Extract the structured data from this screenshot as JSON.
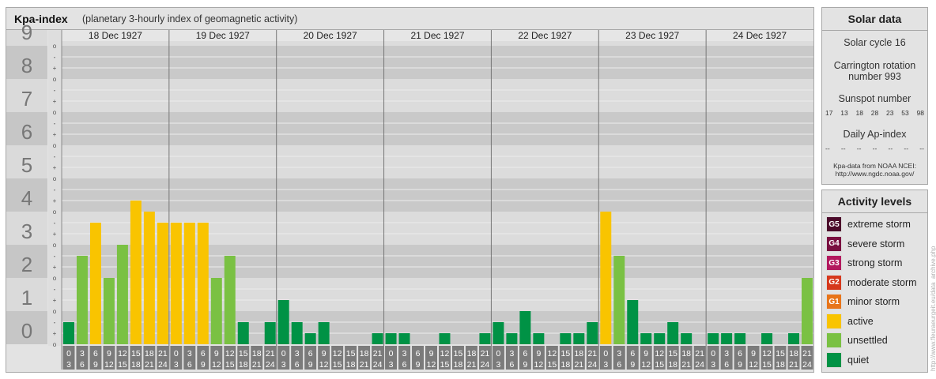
{
  "header": {
    "title": "Kpa-index",
    "subtitle": "(planetary 3-hourly index of geomagnetic activity)"
  },
  "chart_data": {
    "type": "bar",
    "y_axis_labels": [
      "0",
      "1",
      "2",
      "3",
      "4",
      "5",
      "6",
      "7",
      "8",
      "9"
    ],
    "minor_ticks": [
      "o",
      "+",
      "-"
    ],
    "ylim": [
      0,
      9
    ],
    "days": [
      "18 Dec 1927",
      "19 Dec 1927",
      "20 Dec 1927",
      "21 Dec 1927",
      "22 Dec 1927",
      "23 Dec 1927",
      "24 Dec 1927"
    ],
    "interval_starts": [
      "0",
      "3",
      "6",
      "9",
      "12",
      "15",
      "18",
      "21"
    ],
    "interval_ends": [
      "3",
      "6",
      "9",
      "12",
      "15",
      "18",
      "21",
      "24"
    ],
    "values": [
      [
        0.667,
        2.667,
        3.667,
        2.0,
        3.0,
        4.333,
        4.0,
        3.667
      ],
      [
        3.667,
        3.667,
        3.667,
        2.0,
        2.667,
        0.667,
        0.0,
        0.667
      ],
      [
        1.333,
        0.667,
        0.333,
        0.667,
        0.0,
        0.0,
        0.0,
        0.333
      ],
      [
        0.333,
        0.333,
        0.0,
        0.0,
        0.333,
        0.0,
        0.0,
        0.333
      ],
      [
        0.667,
        0.333,
        1.0,
        0.333,
        0.0,
        0.333,
        0.333,
        0.667
      ],
      [
        4.0,
        2.667,
        1.333,
        0.333,
        0.333,
        0.667,
        0.333,
        0.0
      ],
      [
        0.333,
        0.333,
        0.333,
        0.0,
        0.333,
        0.0,
        0.333,
        2.0
      ]
    ],
    "grid": true,
    "level_colors": {
      "quiet": "#009245",
      "unsettled": "#7ac143",
      "active": "#f9c400"
    }
  },
  "solar": {
    "title": "Solar data",
    "cycle": "Solar cycle 16",
    "carrington_line1": "Carrington rotation",
    "carrington_line2": "number 993",
    "sunspot_title": "Sunspot number",
    "sunspots": [
      "17",
      "13",
      "18",
      "28",
      "23",
      "53",
      "98"
    ],
    "ap_title": "Daily Ap-index",
    "ap_values": [
      "--",
      "--",
      "--",
      "--",
      "--",
      "--",
      "--"
    ],
    "source_line1": "Kpa-data from NOAA NCEI:",
    "source_line2": "http://www.ngdc.noaa.gov/"
  },
  "activity": {
    "title": "Activity levels",
    "items": [
      {
        "badge": "G5",
        "label": "extreme storm",
        "color": "#4b0a2a"
      },
      {
        "badge": "G4",
        "label": "severe storm",
        "color": "#7a0f40"
      },
      {
        "badge": "G3",
        "label": "strong storm",
        "color": "#b3195e"
      },
      {
        "badge": "G2",
        "label": "moderate storm",
        "color": "#d6381c"
      },
      {
        "badge": "G1",
        "label": "minor storm",
        "color": "#e8751a"
      },
      {
        "badge": "",
        "label": "active",
        "color": "#f9c400"
      },
      {
        "badge": "",
        "label": "unsettled",
        "color": "#7ac143"
      },
      {
        "badge": "",
        "label": "quiet",
        "color": "#009245"
      }
    ]
  },
  "credit": "http://www.fleuraeurgeit.eu/data_archive.php"
}
